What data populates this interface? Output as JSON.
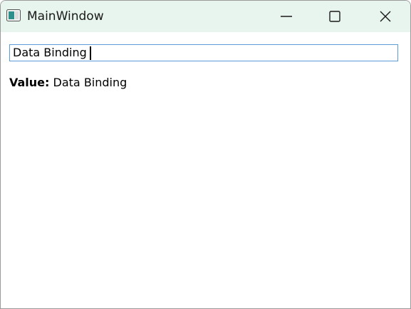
{
  "window": {
    "title": "MainWindow",
    "icon": "app-window-icon",
    "controls": [
      "minimize-icon",
      "maximize-icon",
      "close-icon"
    ]
  },
  "input": {
    "value": "Data Binding"
  },
  "output": {
    "label": "Value:",
    "value": "Data Binding"
  },
  "colors": {
    "titlebar": "#e8f5ee",
    "input_border": "#5a9bd8",
    "background": "#ffffff"
  }
}
